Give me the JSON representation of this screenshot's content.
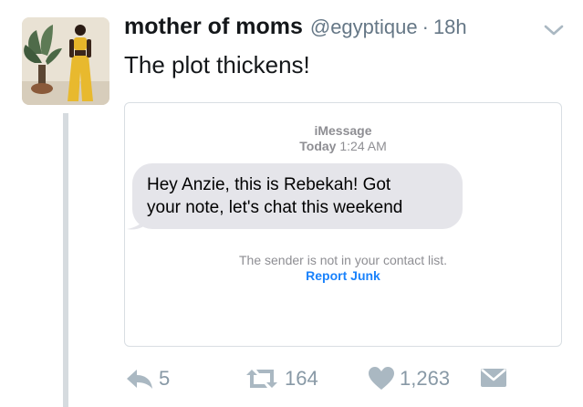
{
  "tweet": {
    "display_name": "mother of moms",
    "handle": "@egyptique",
    "separator": "·",
    "timestamp": "18h",
    "text": "The plot thickens!"
  },
  "imessage": {
    "service": "iMessage",
    "date_label": "Today",
    "time": "1:24 AM",
    "message_line1": "Hey Anzie, this is Rebekah! Got",
    "message_line2": "your note, let's chat this weekend",
    "notice": "The sender is not in your contact list.",
    "report_label": "Report Junk"
  },
  "actions": {
    "replies": "5",
    "retweets": "164",
    "likes": "1,263"
  },
  "colors": {
    "accent_blue": "#1a82fb",
    "muted": "#8899a6",
    "bubble_gray": "#e5e5ea"
  }
}
